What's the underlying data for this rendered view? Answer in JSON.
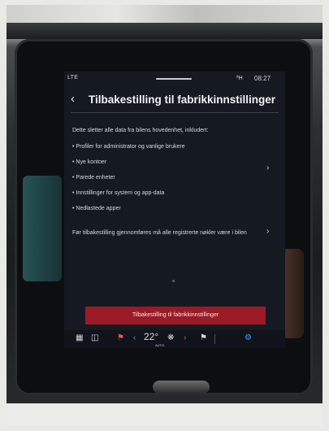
{
  "status_bar": {
    "network": "LTE",
    "bt": "ªH",
    "time": "08:27"
  },
  "header": {
    "title": "Tilbakestilling til fabrikkinnstillinger"
  },
  "content": {
    "intro": "Dette sletter alle data fra bilens hovedenhet, inkludert:",
    "items": [
      "Profiler for administrator og vanlige brukere",
      "Nye kontoer",
      "Parede enheter",
      "Innstillinger for system og app-data",
      "Nedlastede apper"
    ],
    "note": "Før tilbakestilling gjennomføres må alle registrerte nøkler være i bilen"
  },
  "action": {
    "reset_label": "Tilbakestilling til fabrikkinnstillinger"
  },
  "climate_bar": {
    "temperature": "22°",
    "auto_label": "AUTO"
  },
  "colors": {
    "screen_bg": "#151922",
    "button_red": "#9b1a25",
    "accent_blue": "#3aa0ff"
  },
  "icons": {
    "back": "chevron-left-icon",
    "chevron": "chevron-right-icon",
    "grid": "app-grid-icon",
    "camera": "camera-icon",
    "seat": "seat-icon",
    "fan": "fan-icon",
    "seat_heat": "seat-heat-icon",
    "settings": "gear-icon"
  }
}
